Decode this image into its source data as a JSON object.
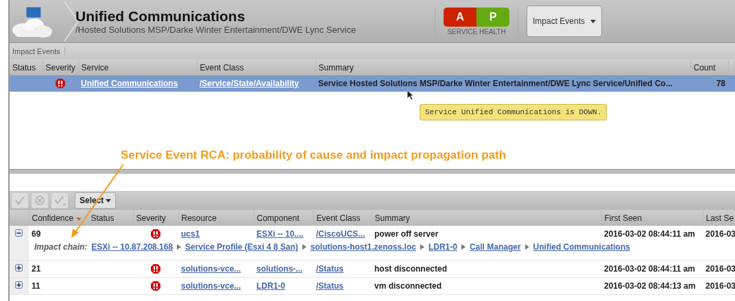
{
  "header": {
    "title": "Unified Communications",
    "path": "/Hosted Solutions MSP/Darke Winter Entertainment/DWE Lync Service",
    "health": {
      "label": "SERVICE HEALTH",
      "cells": [
        {
          "text": "A",
          "color": "#cc2200"
        },
        {
          "text": "P",
          "color": "#66aa11"
        }
      ]
    },
    "menu_button": "Impact Events"
  },
  "toolbar": {
    "label": "Impact Events"
  },
  "impact_table": {
    "columns": [
      "Status",
      "Severity",
      "Service",
      "Event Class",
      "Summary",
      "Count"
    ],
    "rows": [
      {
        "selected": true,
        "critical": true,
        "service": "Unified Communications",
        "event_class": "/Service/State/Availability",
        "summary": "Service Hosted Solutions MSP/Darke Winter Entertainment/DWE Lync Service/Unified Co...",
        "count": "78"
      }
    ]
  },
  "tooltip": "Service Unified Communications is DOWN.",
  "annotation": "Service Event RCA: probability of cause and impact propagation path",
  "event_toolbar": {
    "select_button": "Select"
  },
  "event_table": {
    "columns": [
      {
        "label": "Confidence",
        "sorted": true
      },
      {
        "label": "Status",
        "sorted": false
      },
      {
        "label": "Severity",
        "sorted": false
      },
      {
        "label": "Resource",
        "sorted": false
      },
      {
        "label": "Component",
        "sorted": false
      },
      {
        "label": "Event Class",
        "sorted": false
      },
      {
        "label": "Summary",
        "sorted": false
      },
      {
        "label": "First Seen",
        "sorted": false
      },
      {
        "label": "Last Se",
        "sorted": false
      }
    ],
    "rows": [
      {
        "expanded": true,
        "confidence": "69",
        "critical": true,
        "resource": "ucs1",
        "component": "ESXi -- 10....",
        "event_class": "/CiscoUCS...",
        "summary": "power off server",
        "first_seen": "2016-03-02 08:44:11 am",
        "last_seen": "2016-03",
        "impact_chain": {
          "label": "Impact chain:",
          "links": [
            "ESXi -- 10.87.208.168",
            "Service Profile (Esxi 4 8 San)",
            "solutions-host1.zenoss.loc",
            "LDR1-0",
            "Call Manager",
            "Unified Communications"
          ]
        }
      },
      {
        "expanded": false,
        "confidence": "21",
        "critical": true,
        "resource": "solutions-vce...",
        "component": "solutions-...",
        "event_class": "/Status",
        "summary": "host disconnected",
        "first_seen": "2016-03-02 08:44:11 am",
        "last_seen": "2016-03"
      },
      {
        "expanded": false,
        "confidence": "11",
        "critical": true,
        "resource": "solutions-vce...",
        "component": "LDR1-0",
        "event_class": "/Status",
        "summary": "vm disconnected",
        "first_seen": "2016-03-02 08:44:13 am",
        "last_seen": "2016-03"
      }
    ]
  }
}
